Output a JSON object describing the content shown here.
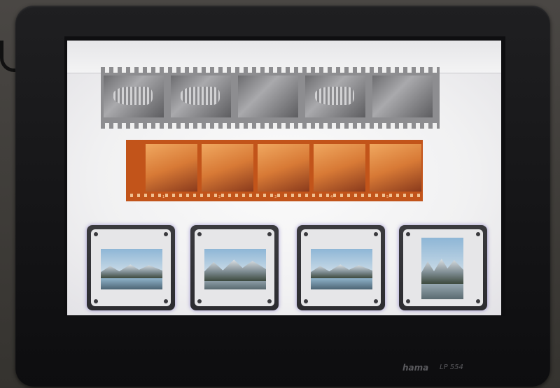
{
  "device": {
    "brand": "hama",
    "model": "LP 554"
  },
  "bw_negative_strip": {
    "frames": 5
  },
  "color_negative_strip": {
    "frame_numbers": [
      "1",
      "2",
      "3",
      "4",
      "5"
    ]
  },
  "slides": [
    {
      "subject": "mountain lake"
    },
    {
      "subject": "rocky mountains"
    },
    {
      "subject": "glacier lake"
    },
    {
      "subject": "snowy peaks"
    }
  ],
  "colors": {
    "lightbox_glow": "#f5f5f6",
    "orange_film": "#c2541a",
    "mount": "#e6e6e8"
  }
}
